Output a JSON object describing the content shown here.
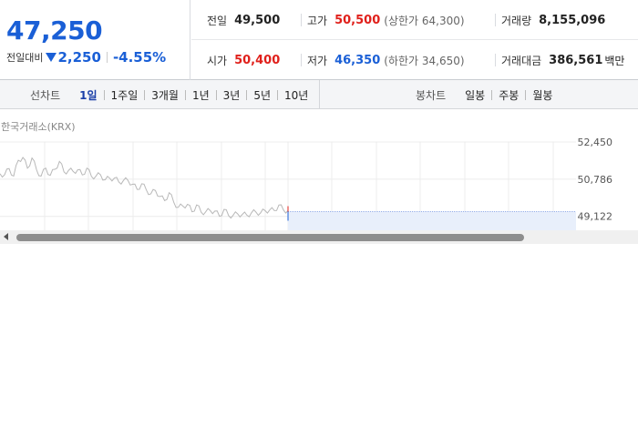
{
  "price": {
    "current": "47,250",
    "change_label": "전일대비",
    "change_value": "2,250",
    "change_rate": "-4.55%"
  },
  "stats": {
    "prev_close": {
      "label": "전일",
      "value": "49,500"
    },
    "high": {
      "label": "고가",
      "value": "50,500",
      "sub": "(상한가 64,300)"
    },
    "volume": {
      "label": "거래량",
      "value": "8,155,096"
    },
    "open": {
      "label": "시가",
      "value": "50,400"
    },
    "low": {
      "label": "저가",
      "value": "46,350",
      "sub": "(하한가 34,650)"
    },
    "amount": {
      "label": "거래대금",
      "value": "386,561",
      "unit": "백만"
    }
  },
  "toolbar": {
    "line_title": "선차트",
    "line_periods": [
      "1일",
      "1주일",
      "3개월",
      "1년",
      "3년",
      "5년",
      "10년"
    ],
    "line_active": "1일",
    "candle_title": "봉차트",
    "candle_periods": [
      "일봉",
      "주봉",
      "월봉"
    ]
  },
  "chart": {
    "exchange": "한국거래소(KRX)",
    "y_ticks": [
      "52,450",
      "50,786",
      "49,122"
    ]
  },
  "chart_data": {
    "type": "line",
    "y_ticks": [
      52450,
      50786,
      49122
    ],
    "ylim": [
      48500,
      52450
    ],
    "reference_value": 49500,
    "series": [
      {
        "values": [
          51150,
          50900,
          51300,
          51050,
          51550,
          51800,
          51400,
          51650,
          51250,
          51050,
          51200,
          51000,
          51350,
          51500,
          51150,
          51300,
          51050,
          51250,
          51100,
          51200,
          50950,
          51050,
          50900,
          50800,
          50950,
          50750,
          50700,
          50850,
          50650,
          50600,
          50450,
          50500,
          50350,
          50250,
          50200,
          50050,
          49950,
          50100,
          49800,
          49650,
          49500,
          49700,
          49450,
          49550,
          49350,
          49450,
          49300,
          49400,
          49250,
          49350,
          49200,
          49300,
          49150,
          49250,
          49300,
          49200,
          49350,
          49400,
          49300,
          49450,
          49500,
          49550,
          49450,
          49500
        ]
      }
    ]
  }
}
